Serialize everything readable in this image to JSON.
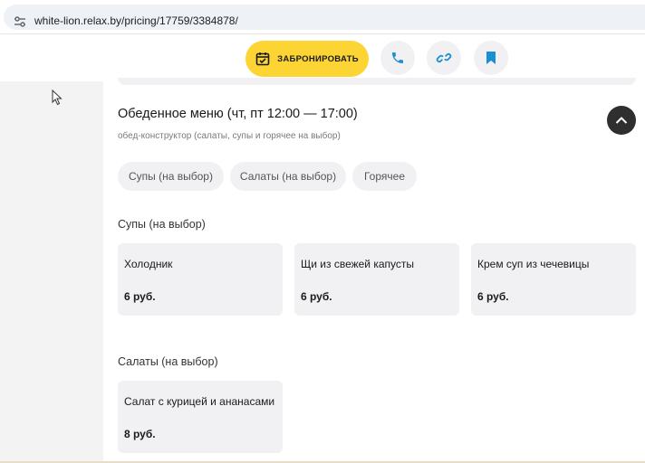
{
  "browser": {
    "url": "white-lion.relax.by/pricing/17759/3384878/"
  },
  "header": {
    "book_label": "ЗАБРОНИРОВАТЬ",
    "icons": [
      "calendar-icon",
      "phone-icon",
      "link-icon",
      "bookmark-icon"
    ],
    "accent_color": "#fcd535",
    "icon_color": "#1a8fd1"
  },
  "menu": {
    "title": "Обеденное меню (чт, пт 12:00 — 17:00)",
    "subtitle": "обед-конструктор (салаты, супы и горячее на выбор)",
    "chips": [
      {
        "label": "Супы (на выбор)"
      },
      {
        "label": "Салаты (на выбор)"
      },
      {
        "label": "Горячее"
      }
    ],
    "groups": [
      {
        "title": "Супы (на выбор)",
        "items": [
          {
            "name": "Холодник",
            "price": "6 руб."
          },
          {
            "name": "Щи из свежей капусты",
            "price": "6 руб."
          },
          {
            "name": "Крем суп из чечевицы",
            "price": "6 руб."
          }
        ]
      },
      {
        "title": "Салаты (на выбор)",
        "items": [
          {
            "name": "Салат с курицей и ананасами",
            "price": "8 руб."
          }
        ]
      }
    ]
  }
}
